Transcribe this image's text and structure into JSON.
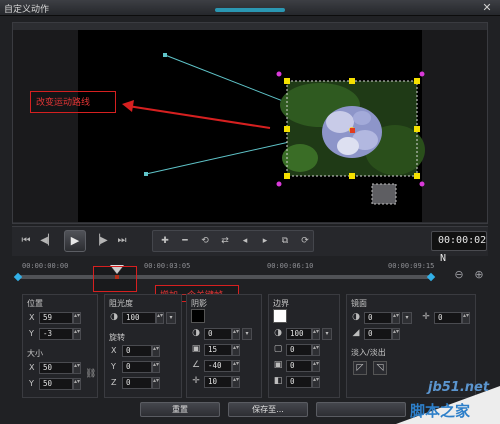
{
  "window": {
    "title": "自定义动作",
    "close_icon": "close-icon"
  },
  "annotations": {
    "motion_path": "改变运动路线",
    "add_keyframe": "增加一个关键帧"
  },
  "playback": {
    "timecode": "00:00:02",
    "timecode_suffix": "N",
    "buttons": [
      "go-to-start-icon",
      "prev-frame-icon",
      "play-icon",
      "next-frame-icon",
      "go-to-end-icon"
    ],
    "keyframe_tools": [
      "add-keyframe-icon",
      "remove-keyframe-icon",
      "reverse-keyframe-icon",
      "move-left-icon",
      "move-right-icon",
      "copy-icon",
      "paste-icon",
      "reset-icon"
    ]
  },
  "timeline": {
    "ticks": [
      "00:00:00:00",
      "00:00:03:05",
      "00:00:06:10",
      "00:00:09:15"
    ],
    "playhead_position": 0.24,
    "keyframes": [
      0.0,
      0.24,
      1.0
    ]
  },
  "position": {
    "title": "位置",
    "x_label": "X",
    "x_value": "59",
    "y_label": "Y",
    "y_value": "-3"
  },
  "size": {
    "title": "大小",
    "x_label": "X",
    "x_value": "50",
    "y_label": "Y",
    "y_value": "50"
  },
  "opacity": {
    "title": "阻光度",
    "value": "100"
  },
  "rotation": {
    "title": "旋转",
    "x_label": "X",
    "x_value": "0",
    "y_label": "Y",
    "y_value": "0",
    "z_label": "Z",
    "z_value": "0"
  },
  "shadow": {
    "title": "阴影",
    "color": "#000000",
    "opacity_value": "0",
    "blur_value": "15",
    "angle_value": "-40",
    "distance_value": "10"
  },
  "border": {
    "title": "边界",
    "color": "#ffffff",
    "opacity_value": "100",
    "width_value": "0",
    "blur_value": "0",
    "extra_value": "0"
  },
  "mirror": {
    "title": "镜面",
    "value1": "0",
    "value2": "0",
    "value3": "0"
  },
  "fade": {
    "title": "淡入/淡出"
  },
  "footer": {
    "reset_label": "重置",
    "save_as_label": "保存至..."
  },
  "watermark": {
    "line1": "jb51.net",
    "line2": "脚本之家"
  },
  "colors": {
    "accent": "#2aa9c9",
    "annotation": "#d62020",
    "handle": "#f5e000",
    "path": "#5fc4c9"
  }
}
